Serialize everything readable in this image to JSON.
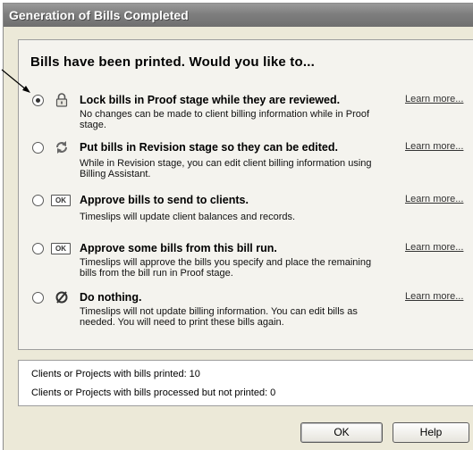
{
  "window": {
    "title": "Generation of Bills Completed"
  },
  "heading": "Bills have been printed. Would you like to...",
  "options": [
    {
      "title": "Lock bills in Proof stage while they are reviewed.",
      "description": "No changes can be made to client billing information while in Proof stage.",
      "learn_more": "Learn more...",
      "icon": "lock-icon",
      "checked": true
    },
    {
      "title": "Put bills in Revision stage so they can be edited.",
      "description": "While in Revision stage, you can edit client billing information using Billing Assistant.",
      "learn_more": "Learn more...",
      "icon": "revision-arrows-icon",
      "checked": false
    },
    {
      "title": "Approve bills to send to clients.",
      "description": "Timeslips will update client balances and records.",
      "learn_more": "Learn more...",
      "icon": "ok-badge-icon",
      "icon_text": "OK",
      "checked": false
    },
    {
      "title": "Approve some bills from this bill run.",
      "description": "Timeslips will approve the bills you specify and place the remaining bills from the bill run in Proof stage.",
      "learn_more": "Learn more...",
      "icon": "ok-badge-icon",
      "icon_text": "OK",
      "checked": false
    },
    {
      "title": "Do nothing.",
      "description": "Timeslips will not update billing information. You can edit bills as needed. You will need to print these bills again.",
      "learn_more": "Learn more...",
      "icon": "no-symbol-icon",
      "checked": false
    }
  ],
  "status": {
    "printed": "Clients or Projects with bills printed: 10",
    "not_printed": "Clients or Projects with bills processed but not printed: 0"
  },
  "buttons": {
    "ok": "OK",
    "help": "Help"
  }
}
